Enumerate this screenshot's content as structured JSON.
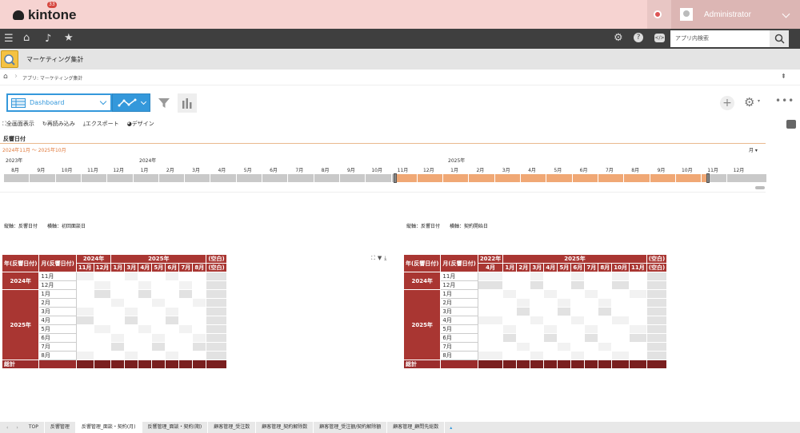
{
  "header": {
    "logo": "kintone",
    "user": "Administrator"
  },
  "nav": {
    "notif_count": "33",
    "search_placeholder": "アプリ内検索"
  },
  "app": {
    "title": "マーケティング集計",
    "breadcrumb": "アプリ: マーケティング集計"
  },
  "toolbar": {
    "view": "Dashboard"
  },
  "subbar": {
    "full": "全画面表示",
    "reload": "再読み込み",
    "export": "エクスポート",
    "design": "デザイン"
  },
  "timeline": {
    "field": "反響日付",
    "range": "2024年11月 〜 2025年10月",
    "unit": "月",
    "years": [
      "2023年",
      "2024年",
      "2025年"
    ],
    "months": [
      "8月",
      "9月",
      "10月",
      "11月",
      "12月",
      "1月",
      "2月",
      "3月",
      "4月",
      "5月",
      "6月",
      "7月",
      "8月",
      "9月",
      "10月",
      "11月",
      "12月",
      "1月",
      "2月",
      "3月",
      "4月",
      "5月",
      "6月",
      "7月",
      "8月",
      "9月",
      "10月",
      "11月",
      "12月"
    ],
    "selection_start_fraction": 0.514,
    "selection_end_fraction": 0.924
  },
  "pivot_left": {
    "caption": "縦軸：反響日付　　横軸：初回面談日",
    "col_h1": "年(反響日付)",
    "col_h2": "月(反響日付)",
    "years": [
      "2024年",
      "2025年",
      "(空白)"
    ],
    "months": [
      "11月",
      "12月",
      "1月",
      "3月",
      "4月",
      "5月",
      "6月",
      "7月",
      "8月",
      "(空白)"
    ],
    "row_year_1": "2024年",
    "row_year_2": "2025年",
    "rows": [
      "11月",
      "12月",
      "1月",
      "2月",
      "3月",
      "4月",
      "5月",
      "6月",
      "7月",
      "8月"
    ],
    "total": "総計"
  },
  "pivot_right": {
    "caption": "縦軸：反響日付　　横軸：契約開始日",
    "col_h1": "年(反響日付)",
    "col_h2": "月(反響日付)",
    "years": [
      "2022年",
      "2025年",
      "(空白)"
    ],
    "months": [
      "4月",
      "1月",
      "2月",
      "3月",
      "4月",
      "5月",
      "6月",
      "7月",
      "8月",
      "10月",
      "11月",
      "(空白)"
    ],
    "row_year_1": "2024年",
    "row_year_2": "2025年",
    "rows": [
      "11月",
      "12月",
      "1月",
      "2月",
      "3月",
      "4月",
      "5月",
      "6月",
      "7月",
      "8月"
    ],
    "total": "総計"
  },
  "tabs": [
    "TOP",
    "反響管理",
    "反響管理_面談・契約(月)",
    "反響管理_面談・契約(期)",
    "顧客管理_受注数",
    "顧客管理_契約解除数",
    "顧客管理_受注額/契約解除額",
    "顧客管理_顧問先総数"
  ]
}
